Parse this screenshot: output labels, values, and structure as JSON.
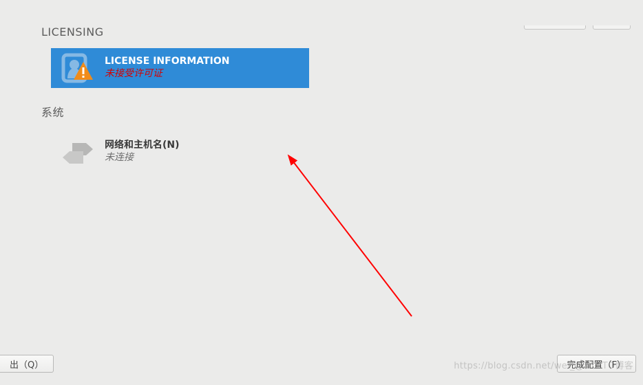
{
  "sections": {
    "licensing": {
      "title": "LICENSING",
      "spoke": {
        "title": "LICENSE INFORMATION",
        "status": "未接受许可证"
      }
    },
    "system": {
      "title": "系统",
      "spoke": {
        "title": "网络和主机名(N)",
        "status": "未连接"
      }
    }
  },
  "footer": {
    "quit": "出（Q）",
    "finish": "完成配置（F）"
  },
  "watermark": "https://blog.csdn.net/wei_@51CTO博客"
}
